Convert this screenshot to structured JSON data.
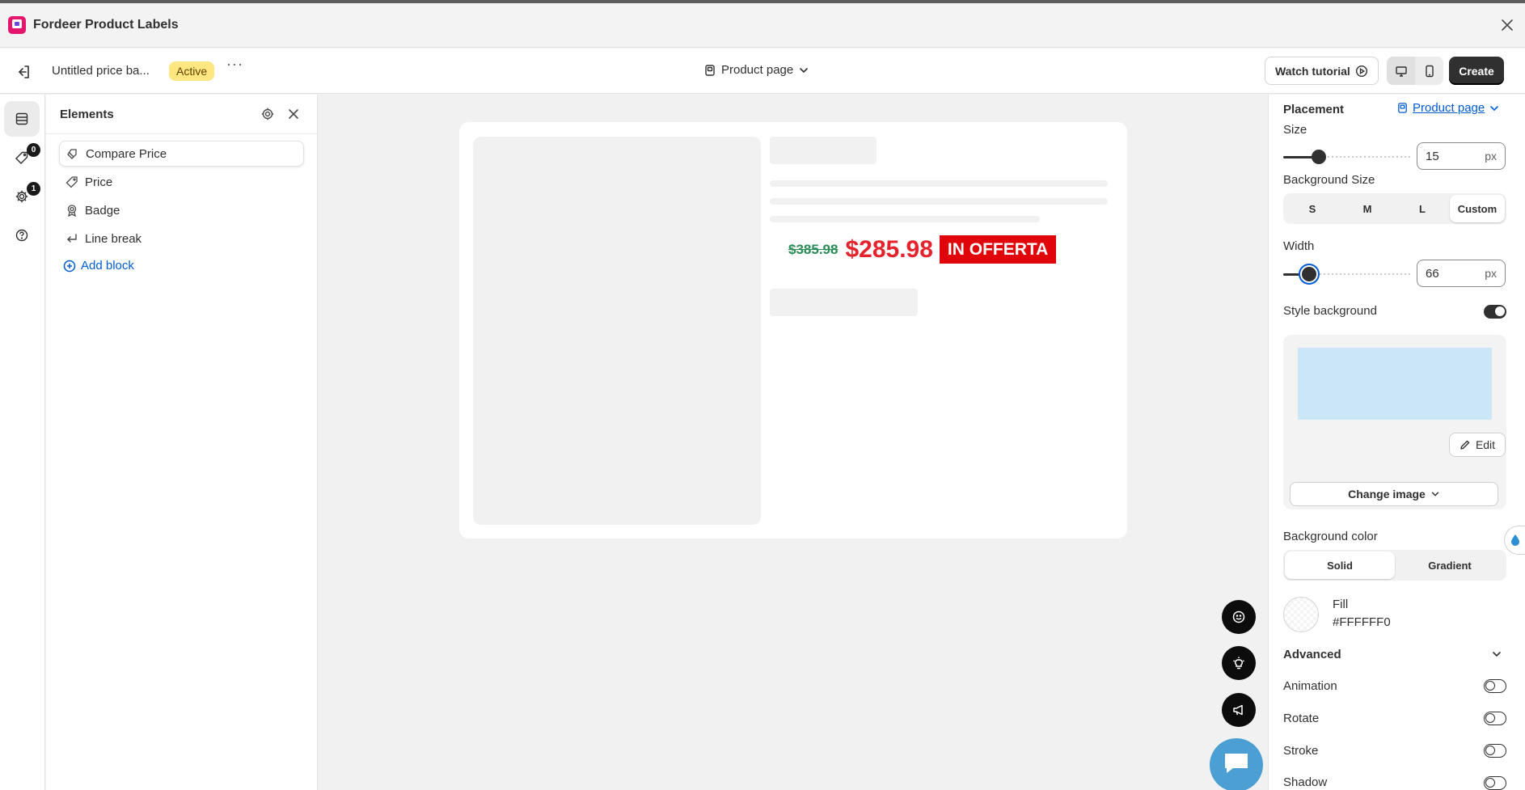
{
  "app": {
    "title": "Fordeer Product Labels"
  },
  "toolbar": {
    "doc_title": "Untitled price ba...",
    "status": "Active",
    "more": "···",
    "page_selector": "Product page",
    "watch_tutorial": "Watch tutorial",
    "create": "Create"
  },
  "rail": {
    "items": [
      {
        "icon": "layout-icon",
        "badge": ""
      },
      {
        "icon": "tag-icon",
        "badge": "0"
      },
      {
        "icon": "gear-icon",
        "badge": "1"
      },
      {
        "icon": "help-icon",
        "badge": ""
      }
    ]
  },
  "elements_panel": {
    "title": "Elements",
    "items": [
      {
        "label": "Compare Price",
        "icon": "compare-price-icon",
        "selected": true
      },
      {
        "label": "Price",
        "icon": "price-tag-icon",
        "selected": false
      },
      {
        "label": "Badge",
        "icon": "badge-icon",
        "selected": false
      },
      {
        "label": "Line break",
        "icon": "line-break-icon",
        "selected": false
      }
    ],
    "add_block": "Add block"
  },
  "preview": {
    "compare_price": "$385.98",
    "price": "$285.98",
    "badge_text": "IN OFFERTA"
  },
  "settings": {
    "placement_label": "Placement",
    "placement_value": "Product page",
    "size_label": "Size",
    "size_value": "15",
    "size_unit": "px",
    "bg_size_label": "Background Size",
    "bg_size_options": [
      "S",
      "M",
      "L",
      "Custom"
    ],
    "bg_size_selected": "Custom",
    "width_label": "Width",
    "width_value": "66",
    "width_unit": "px",
    "style_background_label": "Style background",
    "style_background_on": true,
    "edit_label": "Edit",
    "change_image_label": "Change image",
    "bg_color_label": "Background color",
    "bg_color_modes": [
      "Solid",
      "Gradient"
    ],
    "bg_color_selected": "Solid",
    "fill_label": "Fill",
    "fill_value": "#FFFFFF0",
    "advanced_label": "Advanced",
    "advanced_toggles": [
      {
        "label": "Animation",
        "on": false
      },
      {
        "label": "Rotate",
        "on": false
      },
      {
        "label": "Stroke",
        "on": false
      },
      {
        "label": "Shadow",
        "on": false
      }
    ]
  },
  "colors": {
    "accent_link": "#005bd3",
    "compare_price": "#2a8c56",
    "sale_price": "#e5232c",
    "badge_bg": "#e0040b",
    "status_badge": "#ffe680",
    "bg_preview": "#cbe6f7",
    "chat_fab": "#4c9fd2"
  }
}
